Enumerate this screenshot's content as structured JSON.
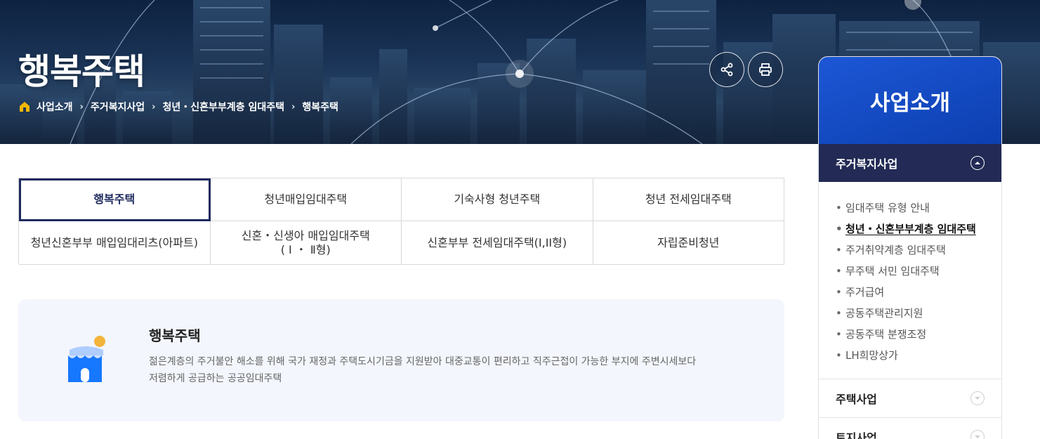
{
  "hero": {
    "title": "행복주택",
    "breadcrumb": [
      "사업소개",
      "주거복지사업",
      "청년・신혼부부계층 임대주택",
      "행복주택"
    ],
    "share_icon": "share-icon",
    "print_icon": "print-icon"
  },
  "tabs": {
    "row1": [
      "행복주택",
      "청년매입임대주택",
      "기숙사형 청년주택",
      "청년 전세임대주택"
    ],
    "row2_0": "청년신혼부부 매입임대리츠(아파트)",
    "row2_1_line1": "신혼・신생아 매입임대주택",
    "row2_1_line2": "( Ⅰ ・ Ⅱ형)",
    "row2_2": "신혼부부 전세임대주택(I,II형)",
    "row2_3": "자립준비청년",
    "active_index": 0
  },
  "info": {
    "title": "행복주택",
    "description_line1": "젊은계층의 주거불안 해소를 위해 국가 재정과 주택도시기금을 지원받아 대중교통이 편리하고 직주근접이 가능한 부지에 주변시세보다",
    "description_line2": "저렴하게 공급하는 공공임대주택"
  },
  "sidebar": {
    "header": "사업소개",
    "open_section": "주거복지사업",
    "items": [
      "임대주택 유형 안내",
      "청년・신혼부부계층 임대주택",
      "주거취약계층 임대주택",
      "무주택 서민 임대주택",
      "주거급여",
      "공동주택관리지원",
      "공동주택 분쟁조정",
      "LH희망상가"
    ],
    "current_index": 1,
    "collapsed_sections": [
      "주택사업",
      "토지사업"
    ]
  },
  "colors": {
    "accent_navy": "#222a55",
    "sidebar_blue": "#1d57d6",
    "info_bg": "#f3f6fc",
    "icon_blue": "#1677ff",
    "icon_sun": "#f2b43a"
  }
}
